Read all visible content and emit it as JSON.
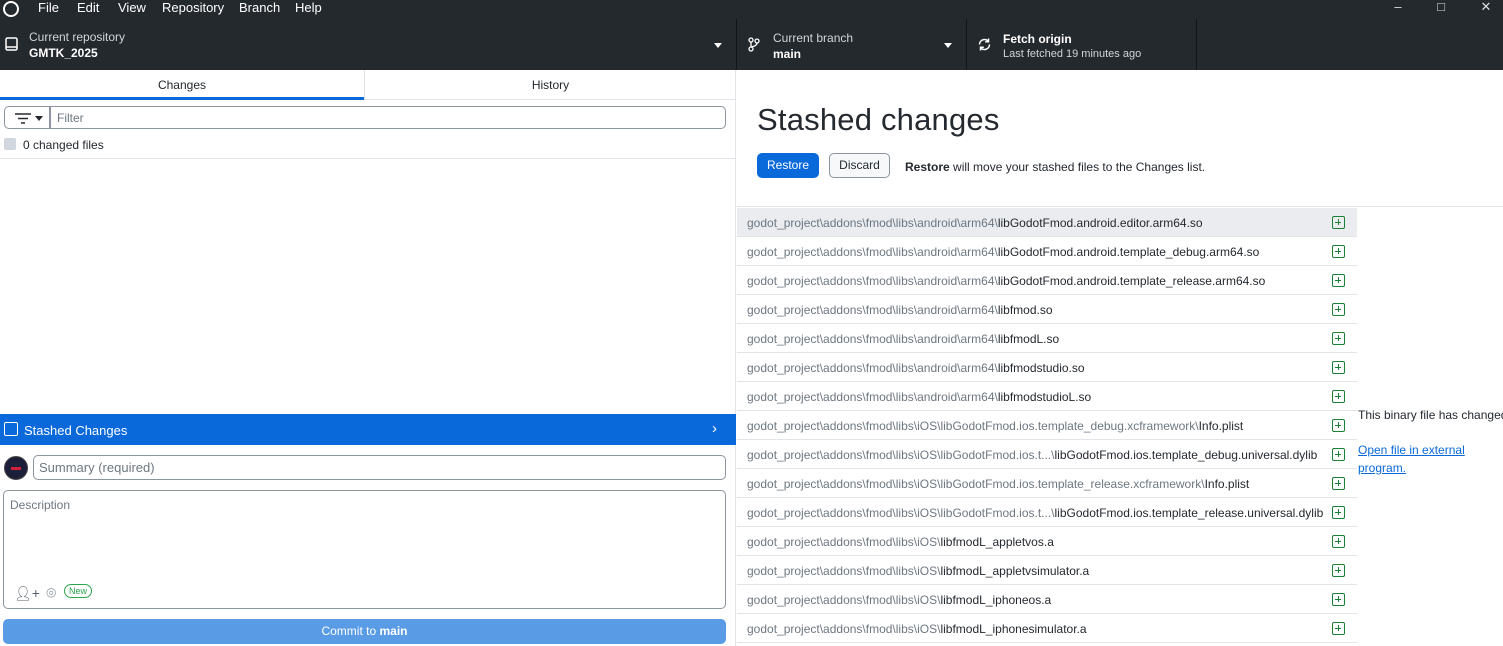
{
  "menu": {
    "items": [
      "File",
      "Edit",
      "View",
      "Repository",
      "Branch",
      "Help"
    ]
  },
  "window": {
    "minimize": "–",
    "maximize": "□",
    "close": "✕"
  },
  "toolbar": {
    "repository": {
      "label": "Current repository",
      "value": "GMTK_2025"
    },
    "branch": {
      "label": "Current branch",
      "value": "main"
    },
    "fetch": {
      "label": "Fetch origin",
      "sub": "Last fetched 19 minutes ago"
    }
  },
  "left": {
    "tabs": [
      "Changes",
      "History"
    ],
    "filter_placeholder": "Filter",
    "changed_files": "0 changed files",
    "stashed_label": "Stashed Changes",
    "summary_placeholder": "Summary (required)",
    "description_placeholder": "Description",
    "new_badge": "New",
    "commit_prefix": "Commit to",
    "commit_branch": "main"
  },
  "right": {
    "title": "Stashed changes",
    "restore_label": "Restore",
    "discard_label": "Discard",
    "hint_bold": "Restore",
    "hint_rest": " will move your stashed files to the Changes list.",
    "binary_message": "This binary file has changed.",
    "open_external": "Open file in external program.",
    "files": [
      {
        "dir": "godot_project\\addons\\fmod\\libs\\android\\arm64\\",
        "name": "libGodotFmod.android.editor.arm64.so"
      },
      {
        "dir": "godot_project\\addons\\fmod\\libs\\android\\arm64\\",
        "name": "libGodotFmod.android.template_debug.arm64.so"
      },
      {
        "dir": "godot_project\\addons\\fmod\\libs\\android\\arm64\\",
        "name": "libGodotFmod.android.template_release.arm64.so"
      },
      {
        "dir": "godot_project\\addons\\fmod\\libs\\android\\arm64\\",
        "name": "libfmod.so"
      },
      {
        "dir": "godot_project\\addons\\fmod\\libs\\android\\arm64\\",
        "name": "libfmodL.so"
      },
      {
        "dir": "godot_project\\addons\\fmod\\libs\\android\\arm64\\",
        "name": "libfmodstudio.so"
      },
      {
        "dir": "godot_project\\addons\\fmod\\libs\\android\\arm64\\",
        "name": "libfmodstudioL.so"
      },
      {
        "dir": "godot_project\\addons\\fmod\\libs\\iOS\\libGodotFmod.ios.template_debug.xcframework\\",
        "name": "Info.plist"
      },
      {
        "dir": "godot_project\\addons\\fmod\\libs\\iOS\\libGodotFmod.ios.t...\\",
        "name": "libGodotFmod.ios.template_debug.universal.dylib"
      },
      {
        "dir": "godot_project\\addons\\fmod\\libs\\iOS\\libGodotFmod.ios.template_release.xcframework\\",
        "name": "Info.plist"
      },
      {
        "dir": "godot_project\\addons\\fmod\\libs\\iOS\\libGodotFmod.ios.t...\\",
        "name": "libGodotFmod.ios.template_release.universal.dylib"
      },
      {
        "dir": "godot_project\\addons\\fmod\\libs\\iOS\\",
        "name": "libfmodL_appletvos.a"
      },
      {
        "dir": "godot_project\\addons\\fmod\\libs\\iOS\\",
        "name": "libfmodL_appletvsimulator.a"
      },
      {
        "dir": "godot_project\\addons\\fmod\\libs\\iOS\\",
        "name": "libfmodL_iphoneos.a"
      },
      {
        "dir": "godot_project\\addons\\fmod\\libs\\iOS\\",
        "name": "libfmodL_iphonesimulator.a"
      }
    ]
  }
}
